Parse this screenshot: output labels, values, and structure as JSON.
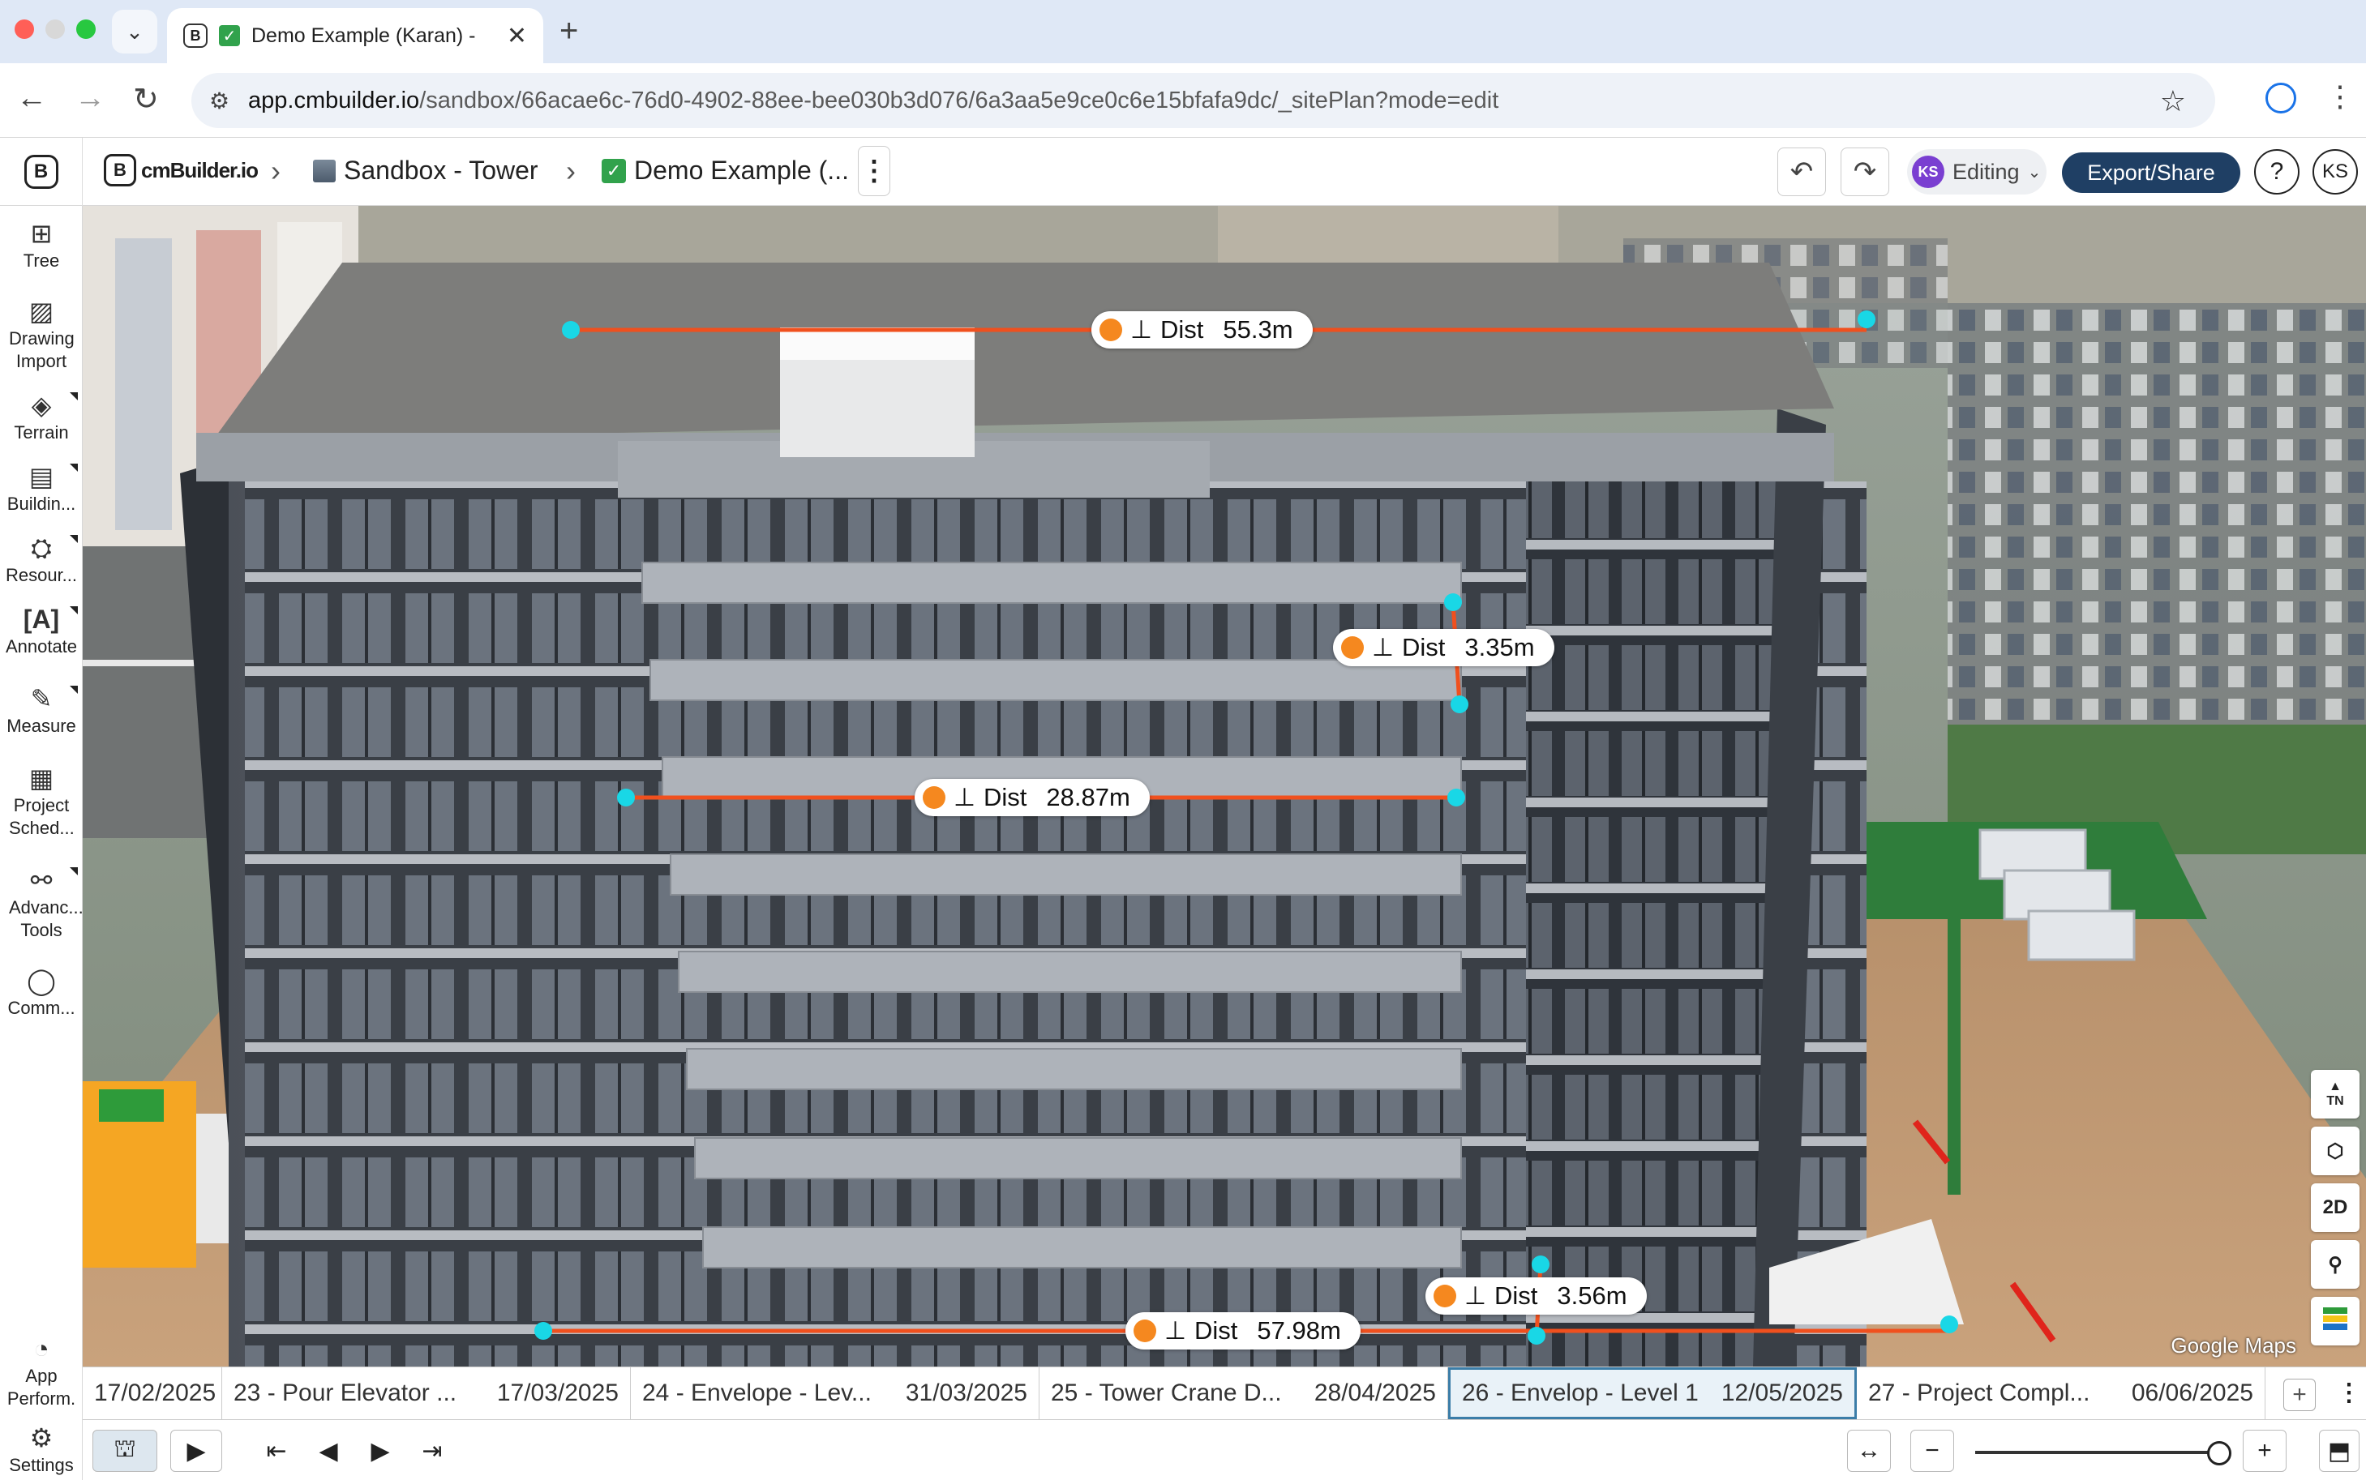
{
  "browser": {
    "tab_title": "Demo Example (Karan) - ",
    "url_host": "app.cmbuilder.io",
    "url_path": "/sandbox/66acae6c-76d0-4902-88ee-bee030b3d076/6a3aa5e9ce0c6e15bfafa9dc/_sitePlan?mode=edit"
  },
  "header": {
    "brand": "cmBuilder.io",
    "crumbs": [
      "Sandbox - Tower",
      "Demo Example (..."
    ],
    "mode": "Editing",
    "user_initials": "KS",
    "export_label": "Export/Share",
    "help_label": "?"
  },
  "sidebar": {
    "items": [
      {
        "label": "Tree",
        "icon": "tree-icon"
      },
      {
        "label": "Drawing Import",
        "icon": "image-icon"
      },
      {
        "label": "Terrain",
        "icon": "layers-icon"
      },
      {
        "label": "Buildin...",
        "icon": "building-icon"
      },
      {
        "label": "Resour...",
        "icon": "resources-icon"
      },
      {
        "label": "Annotate",
        "icon": "annotate-icon"
      },
      {
        "label": "Measure",
        "icon": "ruler-icon"
      },
      {
        "label": "Project Sched...",
        "icon": "calendar-icon"
      },
      {
        "label": "Advanc... Tools",
        "icon": "tools-icon"
      },
      {
        "label": "Comm...",
        "icon": "comment-icon"
      },
      {
        "label": "App Perform.",
        "icon": "gauge-icon"
      },
      {
        "label": "Settings",
        "icon": "gear-icon"
      }
    ]
  },
  "measurements": [
    {
      "symbol": "⊥",
      "label": "Dist",
      "value": "55.3m"
    },
    {
      "symbol": "⊥",
      "label": "Dist",
      "value": "3.35m"
    },
    {
      "symbol": "⊥",
      "label": "Dist",
      "value": "28.87m"
    },
    {
      "symbol": "⊥",
      "label": "Dist",
      "value": "3.56m"
    },
    {
      "symbol": "⊥",
      "label": "Dist",
      "value": "57.98m"
    }
  ],
  "viewport": {
    "attribution": "Google Maps",
    "tools": [
      "TN",
      "",
      "2D",
      "",
      ""
    ]
  },
  "timeline": {
    "segments": [
      {
        "name": "",
        "date": "17/02/2025"
      },
      {
        "name": "23 - Pour Elevator ...",
        "date": "17/03/2025"
      },
      {
        "name": "24 - Envelope - Lev...",
        "date": "31/03/2025"
      },
      {
        "name": "25 - Tower Crane D...",
        "date": "28/04/2025"
      },
      {
        "name": "26 - Envelop - Level 1",
        "date": "12/05/2025"
      },
      {
        "name": "27 - Project Compl...",
        "date": "06/06/2025"
      }
    ],
    "active_index": 4
  },
  "colors": {
    "accent": "#1f3f64",
    "measure_line": "#f0501e",
    "measure_point": "#19d7e6",
    "measure_dot": "#f5881f"
  }
}
